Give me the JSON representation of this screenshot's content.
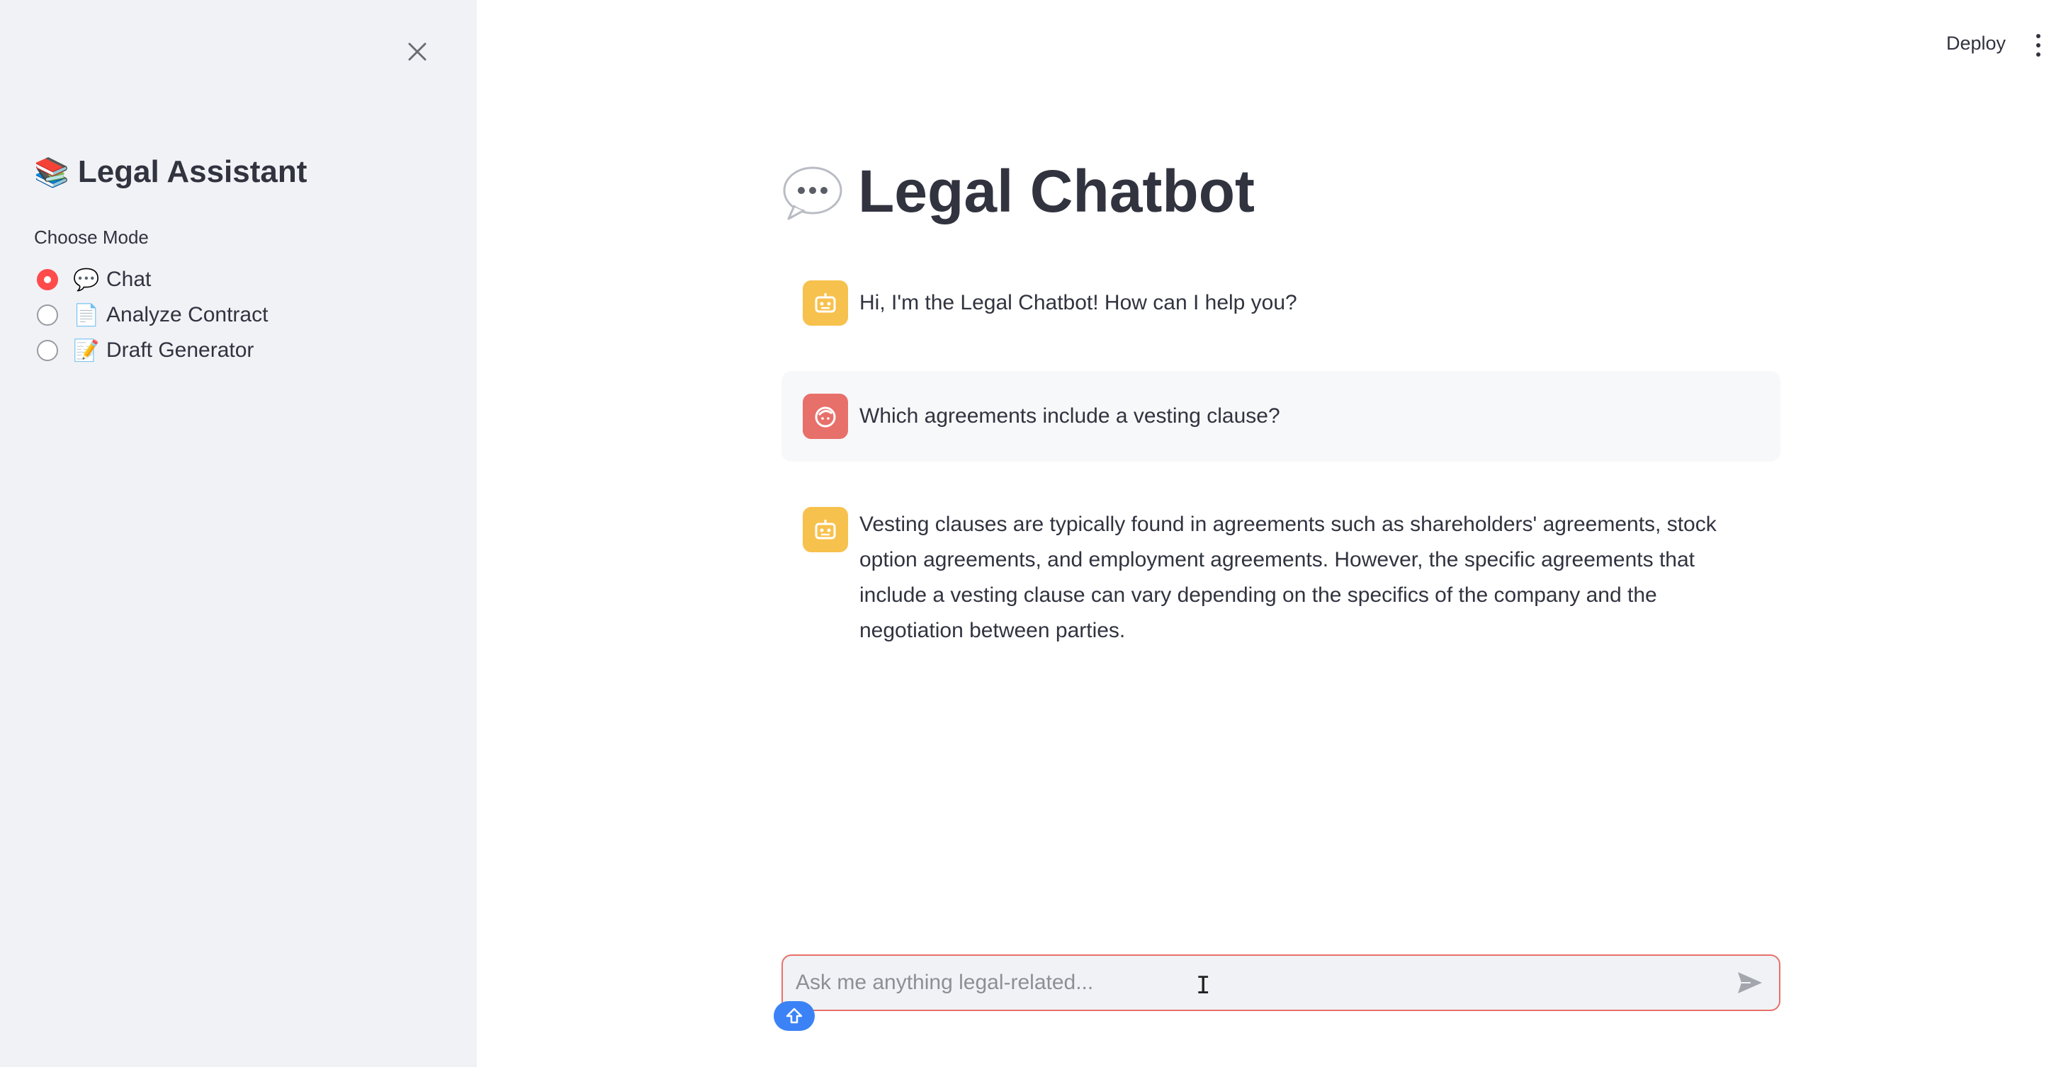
{
  "header": {
    "deploy_label": "Deploy"
  },
  "sidebar": {
    "title_emoji": "📚",
    "title": "Legal Assistant",
    "mode_label": "Choose Mode",
    "modes": [
      {
        "emoji": "💬",
        "label": "Chat",
        "selected": true
      },
      {
        "emoji": "📄",
        "label": "Analyze Contract",
        "selected": false
      },
      {
        "emoji": "📝",
        "label": "Draft Generator",
        "selected": false
      }
    ]
  },
  "main": {
    "title": "Legal Chatbot",
    "messages": [
      {
        "role": "assistant",
        "text": "Hi, I'm the Legal Chatbot! How can I help you?"
      },
      {
        "role": "user",
        "text": "Which agreements include a vesting clause?"
      },
      {
        "role": "assistant",
        "text": "Vesting clauses are typically found in agreements such as shareholders' agreements, stock option agreements, and employment agreements. However, the specific agreements that include a vesting clause can vary depending on the specifics of the company and the negotiation between parties."
      }
    ]
  },
  "chat_input": {
    "placeholder": "Ask me anything legal-related...",
    "value": ""
  },
  "colors": {
    "sidebar_bg": "#f0f2f6",
    "accent": "#ff4b4b",
    "bot_avatar": "#f7c14d",
    "user_avatar": "#e8706a"
  },
  "icons": {
    "close": "close-icon",
    "menu": "kebab-menu-icon",
    "bot": "bot-avatar-icon",
    "user": "user-avatar-icon",
    "send": "send-icon"
  }
}
